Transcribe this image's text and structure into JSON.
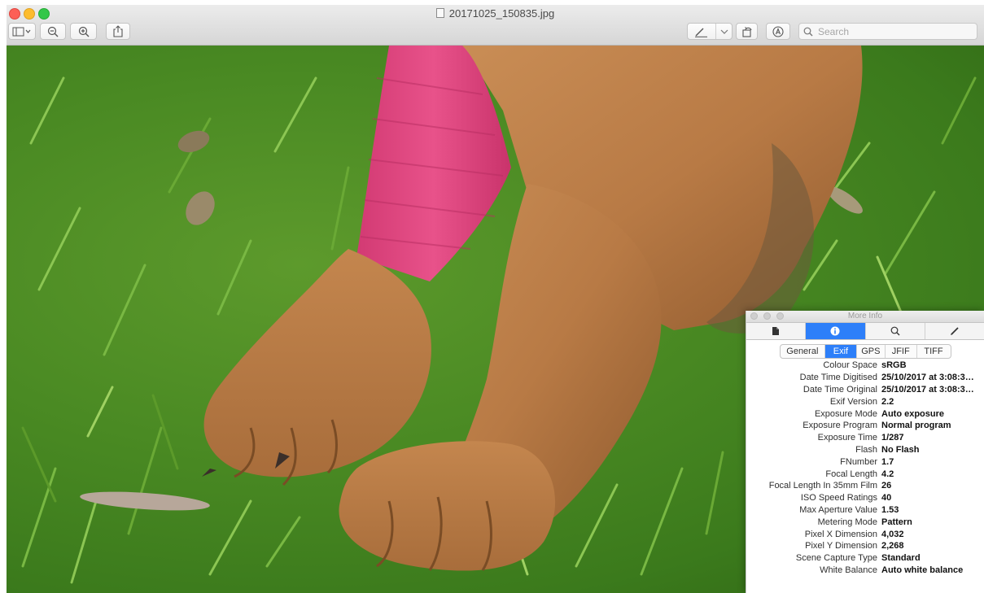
{
  "window": {
    "title": "20171025_150835.jpg"
  },
  "toolbar": {
    "search_placeholder": "Search",
    "icons": [
      "sidebar-toggle-icon",
      "zoom-out-icon",
      "zoom-in-icon",
      "share-icon",
      "markup-pen-icon",
      "rotate-icon",
      "annotate-icon",
      "search-icon"
    ]
  },
  "image": {
    "description_tags": [
      "grass",
      "dog-paws",
      "pink-bandage"
    ]
  },
  "info_panel": {
    "title": "More Info",
    "tabs": [
      "document-icon",
      "info-icon",
      "magnifier-icon",
      "pencil-icon"
    ],
    "active_tab": 1,
    "segments": [
      "General",
      "Exif",
      "GPS",
      "JFIF",
      "TIFF"
    ],
    "active_segment": 1,
    "rows": [
      {
        "key": "Colour Space",
        "value": "sRGB"
      },
      {
        "key": "Date Time Digitised",
        "value": "25/10/2017 at 3:08:35..."
      },
      {
        "key": "Date Time Original",
        "value": "25/10/2017 at 3:08:35..."
      },
      {
        "key": "Exif Version",
        "value": "2.2"
      },
      {
        "key": "Exposure Mode",
        "value": "Auto exposure"
      },
      {
        "key": "Exposure Program",
        "value": "Normal program"
      },
      {
        "key": "Exposure Time",
        "value": "1/287"
      },
      {
        "key": "Flash",
        "value": "No Flash"
      },
      {
        "key": "FNumber",
        "value": "1.7"
      },
      {
        "key": "Focal Length",
        "value": "4.2"
      },
      {
        "key": "Focal Length In 35mm Film",
        "value": "26"
      },
      {
        "key": "ISO Speed Ratings",
        "value": "40"
      },
      {
        "key": "Max Aperture Value",
        "value": "1.53"
      },
      {
        "key": "Metering Mode",
        "value": "Pattern"
      },
      {
        "key": "Pixel X Dimension",
        "value": "4,032"
      },
      {
        "key": "Pixel Y Dimension",
        "value": "2,268"
      },
      {
        "key": "Scene Capture Type",
        "value": "Standard"
      },
      {
        "key": "White Balance",
        "value": "Auto white balance"
      }
    ]
  },
  "colors": {
    "accent": "#2d7ff9",
    "grass": "#4a8a23",
    "fur": "#b87a45",
    "bandage": "#e0457f"
  }
}
